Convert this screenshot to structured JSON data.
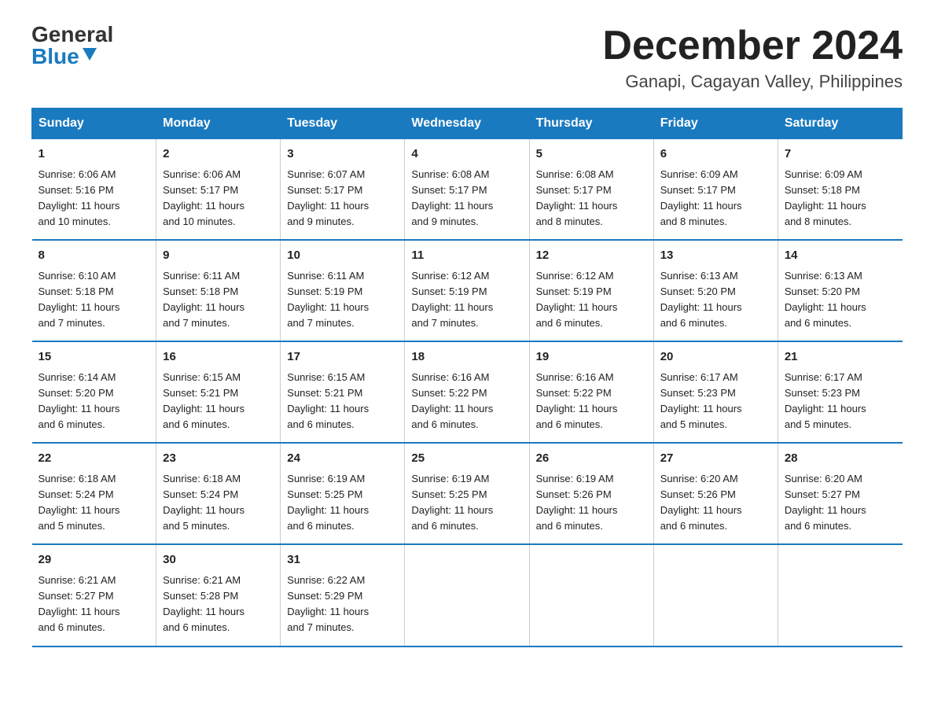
{
  "logo": {
    "general": "General",
    "blue": "Blue"
  },
  "title": "December 2024",
  "location": "Ganapi, Cagayan Valley, Philippines",
  "days_of_week": [
    "Sunday",
    "Monday",
    "Tuesday",
    "Wednesday",
    "Thursday",
    "Friday",
    "Saturday"
  ],
  "weeks": [
    [
      {
        "day": "1",
        "sunrise": "6:06 AM",
        "sunset": "5:16 PM",
        "daylight": "11 hours and 10 minutes."
      },
      {
        "day": "2",
        "sunrise": "6:06 AM",
        "sunset": "5:17 PM",
        "daylight": "11 hours and 10 minutes."
      },
      {
        "day": "3",
        "sunrise": "6:07 AM",
        "sunset": "5:17 PM",
        "daylight": "11 hours and 9 minutes."
      },
      {
        "day": "4",
        "sunrise": "6:08 AM",
        "sunset": "5:17 PM",
        "daylight": "11 hours and 9 minutes."
      },
      {
        "day": "5",
        "sunrise": "6:08 AM",
        "sunset": "5:17 PM",
        "daylight": "11 hours and 8 minutes."
      },
      {
        "day": "6",
        "sunrise": "6:09 AM",
        "sunset": "5:17 PM",
        "daylight": "11 hours and 8 minutes."
      },
      {
        "day": "7",
        "sunrise": "6:09 AM",
        "sunset": "5:18 PM",
        "daylight": "11 hours and 8 minutes."
      }
    ],
    [
      {
        "day": "8",
        "sunrise": "6:10 AM",
        "sunset": "5:18 PM",
        "daylight": "11 hours and 7 minutes."
      },
      {
        "day": "9",
        "sunrise": "6:11 AM",
        "sunset": "5:18 PM",
        "daylight": "11 hours and 7 minutes."
      },
      {
        "day": "10",
        "sunrise": "6:11 AM",
        "sunset": "5:19 PM",
        "daylight": "11 hours and 7 minutes."
      },
      {
        "day": "11",
        "sunrise": "6:12 AM",
        "sunset": "5:19 PM",
        "daylight": "11 hours and 7 minutes."
      },
      {
        "day": "12",
        "sunrise": "6:12 AM",
        "sunset": "5:19 PM",
        "daylight": "11 hours and 6 minutes."
      },
      {
        "day": "13",
        "sunrise": "6:13 AM",
        "sunset": "5:20 PM",
        "daylight": "11 hours and 6 minutes."
      },
      {
        "day": "14",
        "sunrise": "6:13 AM",
        "sunset": "5:20 PM",
        "daylight": "11 hours and 6 minutes."
      }
    ],
    [
      {
        "day": "15",
        "sunrise": "6:14 AM",
        "sunset": "5:20 PM",
        "daylight": "11 hours and 6 minutes."
      },
      {
        "day": "16",
        "sunrise": "6:15 AM",
        "sunset": "5:21 PM",
        "daylight": "11 hours and 6 minutes."
      },
      {
        "day": "17",
        "sunrise": "6:15 AM",
        "sunset": "5:21 PM",
        "daylight": "11 hours and 6 minutes."
      },
      {
        "day": "18",
        "sunrise": "6:16 AM",
        "sunset": "5:22 PM",
        "daylight": "11 hours and 6 minutes."
      },
      {
        "day": "19",
        "sunrise": "6:16 AM",
        "sunset": "5:22 PM",
        "daylight": "11 hours and 6 minutes."
      },
      {
        "day": "20",
        "sunrise": "6:17 AM",
        "sunset": "5:23 PM",
        "daylight": "11 hours and 5 minutes."
      },
      {
        "day": "21",
        "sunrise": "6:17 AM",
        "sunset": "5:23 PM",
        "daylight": "11 hours and 5 minutes."
      }
    ],
    [
      {
        "day": "22",
        "sunrise": "6:18 AM",
        "sunset": "5:24 PM",
        "daylight": "11 hours and 5 minutes."
      },
      {
        "day": "23",
        "sunrise": "6:18 AM",
        "sunset": "5:24 PM",
        "daylight": "11 hours and 5 minutes."
      },
      {
        "day": "24",
        "sunrise": "6:19 AM",
        "sunset": "5:25 PM",
        "daylight": "11 hours and 6 minutes."
      },
      {
        "day": "25",
        "sunrise": "6:19 AM",
        "sunset": "5:25 PM",
        "daylight": "11 hours and 6 minutes."
      },
      {
        "day": "26",
        "sunrise": "6:19 AM",
        "sunset": "5:26 PM",
        "daylight": "11 hours and 6 minutes."
      },
      {
        "day": "27",
        "sunrise": "6:20 AM",
        "sunset": "5:26 PM",
        "daylight": "11 hours and 6 minutes."
      },
      {
        "day": "28",
        "sunrise": "6:20 AM",
        "sunset": "5:27 PM",
        "daylight": "11 hours and 6 minutes."
      }
    ],
    [
      {
        "day": "29",
        "sunrise": "6:21 AM",
        "sunset": "5:27 PM",
        "daylight": "11 hours and 6 minutes."
      },
      {
        "day": "30",
        "sunrise": "6:21 AM",
        "sunset": "5:28 PM",
        "daylight": "11 hours and 6 minutes."
      },
      {
        "day": "31",
        "sunrise": "6:22 AM",
        "sunset": "5:29 PM",
        "daylight": "11 hours and 7 minutes."
      },
      null,
      null,
      null,
      null
    ]
  ],
  "labels": {
    "sunrise": "Sunrise:",
    "sunset": "Sunset:",
    "daylight": "Daylight:"
  }
}
